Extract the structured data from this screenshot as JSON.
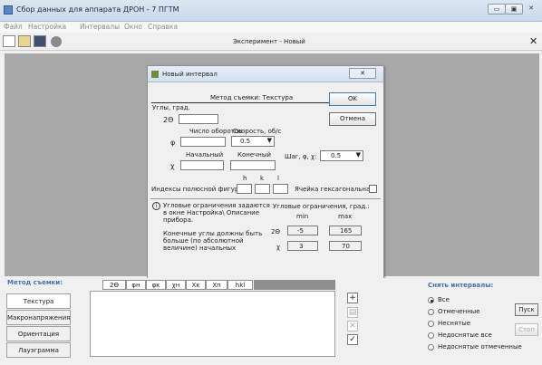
{
  "window": {
    "title": "Сбор данных для аппарата ДРОН - 7 ПГТМ"
  },
  "menu": [
    "Файл",
    "Настройка",
    "Интервалы",
    "Окно",
    "Справка"
  ],
  "document_title": "Эксперимент - Новый",
  "dialog": {
    "title": "Новый интервал",
    "method": "Метод съемки: Текстура",
    "angles_label": "Углы, град.",
    "two_theta_symbol": "2Θ",
    "rotations_label": "Число оборотов",
    "speed_label": "Скорость, об/с",
    "phi_symbol": "φ",
    "speed_value": "0.5",
    "start_label": "Начальный",
    "end_label": "Конечный",
    "chi_symbol": "χ",
    "step_label": "Шаг, φ, χ:",
    "step_value": "0.5",
    "hkl": [
      "h",
      "k",
      "l"
    ],
    "indices_label": "Индексы полюсной фигуры:",
    "hex_label": "Ячейка гексагональная:",
    "info_text": "Угловые ограничения задаются в окне Настройка\\ Описание прибора.",
    "info_text2": "Конечные углы должны быть больше (по абсолютной величине) начальных",
    "limits_title": "Угловые ограничения, град.:",
    "min_label": "min",
    "max_label": "max",
    "two_theta_min": "-5",
    "two_theta_max": "165",
    "chi_min": "3",
    "chi_max": "70",
    "ok_label": "OK",
    "cancel_label": "Отмена"
  },
  "bottom": {
    "method_label": "Метод съемки:",
    "tabs": [
      "Текстура",
      "Макронапряжения",
      "Ориентация",
      "Лауэграмма"
    ],
    "columns": [
      "2Θ",
      "φн",
      "φк",
      "χн",
      "Хк",
      "Хп",
      "hkl"
    ],
    "remove_label": "Снять интервалы:",
    "radios": [
      "Все",
      "Отмеченные",
      "Неснятые",
      "Недоснятые все",
      "Недоснятые отмеченные"
    ],
    "start_label": "Пуск",
    "stop_label": "Стоп"
  }
}
